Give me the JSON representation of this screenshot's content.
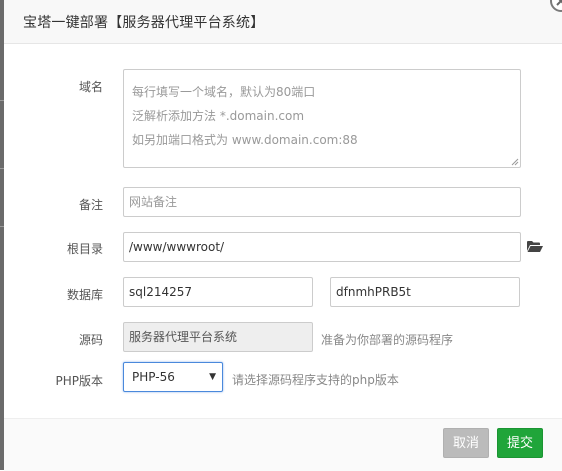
{
  "dialog": {
    "title": "宝塔一键部署【服务器代理平台系统】"
  },
  "form": {
    "domain": {
      "label": "域名",
      "placeholder_lines": [
        "每行填写一个域名，默认为80端口",
        "泛解析添加方法 *.domain.com",
        "如另加端口格式为 www.domain.com:88"
      ]
    },
    "remark": {
      "label": "备注",
      "placeholder": "网站备注"
    },
    "root_dir": {
      "label": "根目录",
      "value": "/www/wwwroot/",
      "icon": "folder-open-icon"
    },
    "database": {
      "label": "数据库",
      "username": "sql214257",
      "password": "dfnmhPRB5t"
    },
    "source": {
      "label": "源码",
      "value": "服务器代理平台系统",
      "hint": "准备为你部署的源码程序"
    },
    "php_version": {
      "label": "PHP版本",
      "selected": "PHP-56",
      "hint": "请选择源码程序支持的php版本"
    }
  },
  "footer": {
    "cancel_label": "取消",
    "submit_label": "提交"
  },
  "colors": {
    "submit": "#20a53a",
    "cancel": "#bbbbbb",
    "focus_border": "#4a89dc"
  }
}
